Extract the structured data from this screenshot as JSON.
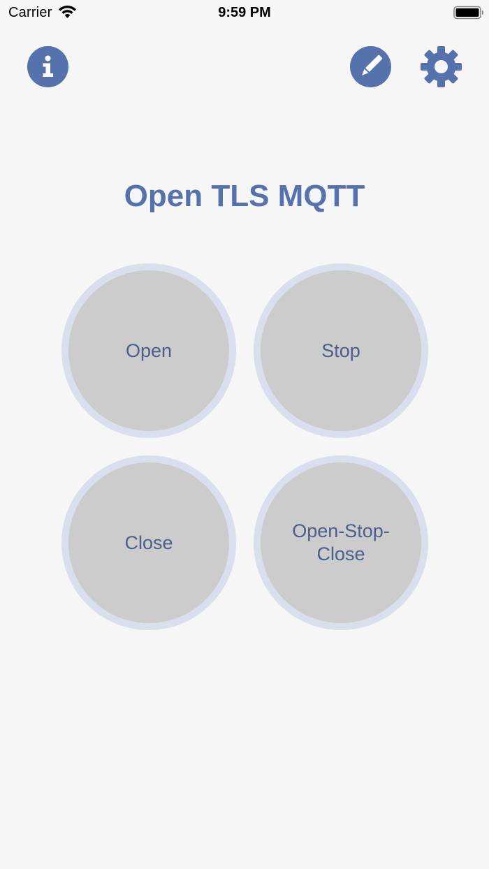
{
  "status_bar": {
    "carrier": "Carrier",
    "time": "9:59 PM",
    "wifi_icon": "wifi-icon",
    "battery_icon": "battery-icon"
  },
  "toolbar": {
    "info_icon": "info-icon",
    "edit_icon": "pencil-icon",
    "settings_icon": "gear-icon"
  },
  "page": {
    "title": "Open TLS MQTT"
  },
  "actions": [
    {
      "label": "Open"
    },
    {
      "label": "Stop"
    },
    {
      "label": "Close"
    },
    {
      "label": "Open-Stop-Close"
    }
  ],
  "colors": {
    "accent": "#5672ac",
    "button_fill": "#cccccc",
    "button_ring": "#d9dfed",
    "button_text": "#4b5f8c",
    "background": "#f6f6f6"
  }
}
